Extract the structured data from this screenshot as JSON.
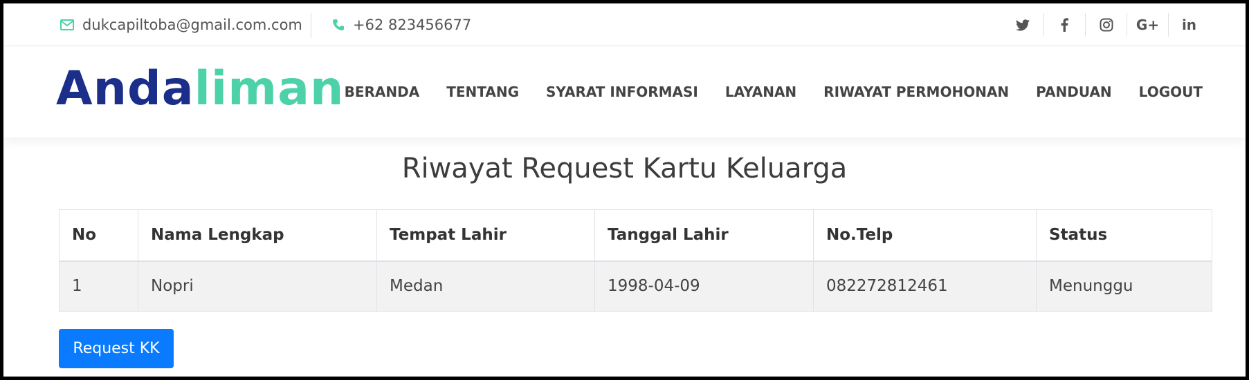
{
  "topbar": {
    "email": "dukcapiltoba@gmail.com.com",
    "phone": "+62 823456677",
    "social": [
      {
        "icon": "twitter-icon",
        "glyph": "🐦"
      },
      {
        "icon": "facebook-icon",
        "glyph": "f"
      },
      {
        "icon": "instagram-icon",
        "glyph": "◎"
      },
      {
        "icon": "google-plus-icon",
        "glyph": "G+"
      },
      {
        "icon": "linkedin-icon",
        "glyph": "in"
      }
    ]
  },
  "header": {
    "logo_part1": "Anda",
    "logo_part2": "liman",
    "nav": [
      "BERANDA",
      "TENTANG",
      "SYARAT INFORMASI",
      "LAYANAN",
      "RIWAYAT PERMOHONAN",
      "PANDUAN",
      "LOGOUT"
    ]
  },
  "main": {
    "title": "Riwayat Request Kartu Keluarga",
    "table": {
      "headers": [
        "No",
        "Nama Lengkap",
        "Tempat Lahir",
        "Tanggal Lahir",
        "No.Telp",
        "Status"
      ],
      "rows": [
        [
          "1",
          "Nopri",
          "Medan",
          "1998-04-09",
          "082272812461",
          "Menunggu"
        ]
      ]
    },
    "button_label": "Request KK"
  },
  "colors": {
    "brand_dark": "#1a2e8a",
    "brand_accent": "#4cd1a8",
    "button": "#0a7bff"
  }
}
